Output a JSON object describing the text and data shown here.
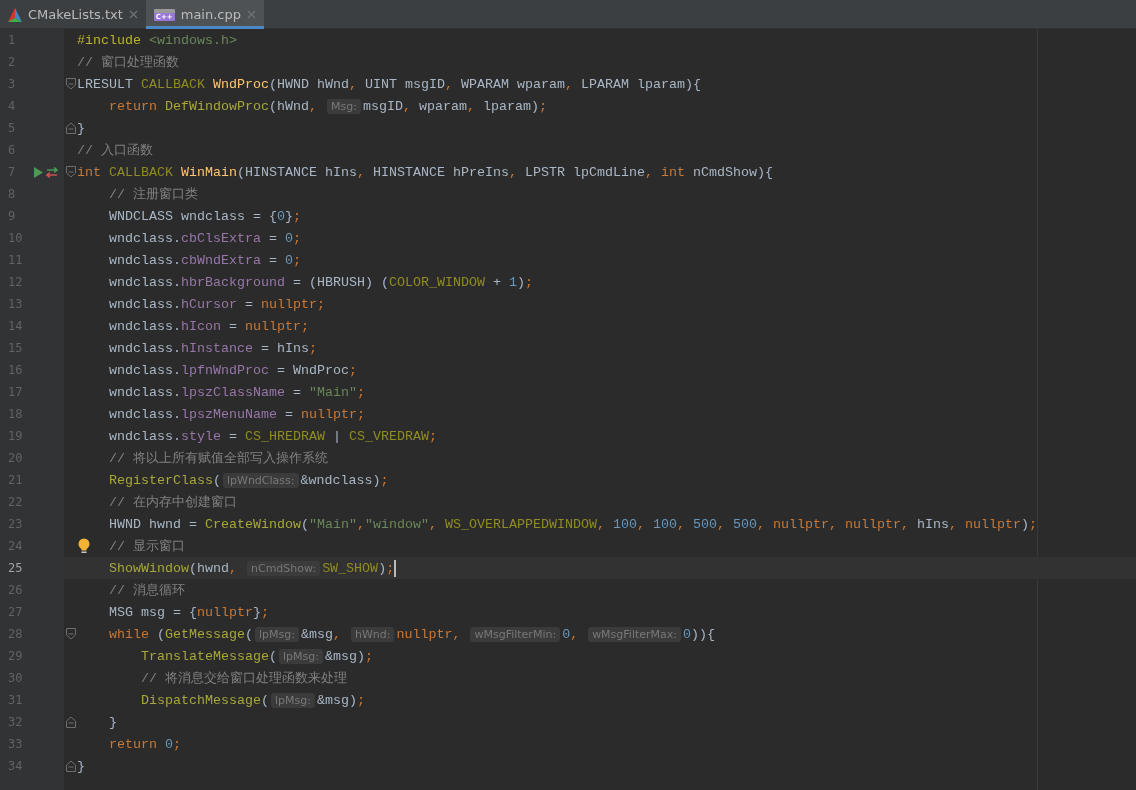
{
  "tabs": [
    {
      "label": "CMakeLists.txt",
      "kind": "cmake",
      "selected": false
    },
    {
      "label": "main.cpp",
      "kind": "cpp",
      "badge": "C++",
      "selected": true
    }
  ],
  "lines": [
    {
      "number": "1",
      "current": false,
      "tokens": [
        {
          "kind": "pre",
          "text": "#include"
        },
        {
          "kind": "str",
          "text": " <windows.h>"
        }
      ]
    },
    {
      "number": "2",
      "current": false,
      "tokens": [
        {
          "kind": "comment",
          "text": "// 窗口处理函数"
        }
      ]
    },
    {
      "number": "3",
      "current": false,
      "fold": {
        "kind": "open"
      },
      "tokens": [
        {
          "kind": "plain",
          "text": "LRESULT"
        },
        {
          "kind": "macro",
          "text": " CALLBACK"
        },
        {
          "kind": "fn",
          "text": " WndProc"
        },
        {
          "kind": "plain",
          "text": "(HWND hWnd"
        },
        {
          "kind": "punct",
          "text": ", "
        },
        {
          "kind": "plain",
          "text": "UINT msgID"
        },
        {
          "kind": "punct",
          "text": ", "
        },
        {
          "kind": "plain",
          "text": "WPARAM wparam"
        },
        {
          "kind": "punct",
          "text": ", "
        },
        {
          "kind": "plain",
          "text": "LPARAM lparam){"
        }
      ]
    },
    {
      "number": "4",
      "current": false,
      "tokens": [
        {
          "kind": "kw",
          "text": "    return"
        },
        {
          "kind": "call",
          "text": " DefWindowProc"
        },
        {
          "kind": "plain",
          "text": "(hWnd"
        },
        {
          "kind": "punct",
          "text": ", "
        },
        {
          "kind": "hint",
          "text": "Msg:"
        },
        {
          "kind": "plain",
          "text": "msgID"
        },
        {
          "kind": "punct",
          "text": ", "
        },
        {
          "kind": "plain",
          "text": "wparam"
        },
        {
          "kind": "punct",
          "text": ", "
        },
        {
          "kind": "plain",
          "text": "lparam)"
        },
        {
          "kind": "punct",
          "text": ";"
        }
      ]
    },
    {
      "number": "5",
      "current": false,
      "fold": {
        "kind": "close"
      },
      "tokens": [
        {
          "kind": "plain",
          "text": "}"
        }
      ]
    },
    {
      "number": "6",
      "current": false,
      "tokens": [
        {
          "kind": "comment",
          "text": "// 入口函数"
        }
      ]
    },
    {
      "number": "7",
      "current": false,
      "gutter": [
        {
          "kind": "run"
        },
        {
          "kind": "swap"
        }
      ],
      "fold": {
        "kind": "open"
      },
      "tokens": [
        {
          "kind": "kw",
          "text": "int"
        },
        {
          "kind": "macro",
          "text": " CALLBACK"
        },
        {
          "kind": "fn",
          "text": " WinMain"
        },
        {
          "kind": "plain",
          "text": "(HINSTANCE hIns"
        },
        {
          "kind": "punct",
          "text": ", "
        },
        {
          "kind": "plain",
          "text": "HINSTANCE hPreIns"
        },
        {
          "kind": "punct",
          "text": ", "
        },
        {
          "kind": "plain",
          "text": "LPSTR lpCmdLine"
        },
        {
          "kind": "punct",
          "text": ", "
        },
        {
          "kind": "kw",
          "text": "int"
        },
        {
          "kind": "plain",
          "text": " nCmdShow){"
        }
      ]
    },
    {
      "number": "8",
      "current": false,
      "tokens": [
        {
          "kind": "comment",
          "text": "    // 注册窗口类"
        }
      ]
    },
    {
      "number": "9",
      "current": false,
      "tokens": [
        {
          "kind": "plain",
          "text": "    WNDCLASS wndclass = {"
        },
        {
          "kind": "num",
          "text": "0"
        },
        {
          "kind": "plain",
          "text": "}"
        },
        {
          "kind": "punct",
          "text": ";"
        }
      ]
    },
    {
      "number": "10",
      "current": false,
      "tokens": [
        {
          "kind": "plain",
          "text": "    wndclass."
        },
        {
          "kind": "field",
          "text": "cbClsExtra"
        },
        {
          "kind": "plain",
          "text": " = "
        },
        {
          "kind": "num",
          "text": "0"
        },
        {
          "kind": "punct",
          "text": ";"
        }
      ]
    },
    {
      "number": "11",
      "current": false,
      "tokens": [
        {
          "kind": "plain",
          "text": "    wndclass."
        },
        {
          "kind": "field",
          "text": "cbWndExtra"
        },
        {
          "kind": "plain",
          "text": " = "
        },
        {
          "kind": "num",
          "text": "0"
        },
        {
          "kind": "punct",
          "text": ";"
        }
      ]
    },
    {
      "number": "12",
      "current": false,
      "tokens": [
        {
          "kind": "plain",
          "text": "    wndclass."
        },
        {
          "kind": "field",
          "text": "hbrBackground"
        },
        {
          "kind": "plain",
          "text": " = (HBRUSH) ("
        },
        {
          "kind": "macro",
          "text": "COLOR_WINDOW"
        },
        {
          "kind": "plain",
          "text": " + "
        },
        {
          "kind": "num",
          "text": "1"
        },
        {
          "kind": "plain",
          "text": ")"
        },
        {
          "kind": "punct",
          "text": ";"
        }
      ]
    },
    {
      "number": "13",
      "current": false,
      "tokens": [
        {
          "kind": "plain",
          "text": "    wndclass."
        },
        {
          "kind": "field",
          "text": "hCursor"
        },
        {
          "kind": "plain",
          "text": " = "
        },
        {
          "kind": "kw",
          "text": "nullptr"
        },
        {
          "kind": "punct",
          "text": ";"
        }
      ]
    },
    {
      "number": "14",
      "current": false,
      "tokens": [
        {
          "kind": "plain",
          "text": "    wndclass."
        },
        {
          "kind": "field",
          "text": "hIcon"
        },
        {
          "kind": "plain",
          "text": " = "
        },
        {
          "kind": "kw",
          "text": "nullptr"
        },
        {
          "kind": "punct",
          "text": ";"
        }
      ]
    },
    {
      "number": "15",
      "current": false,
      "tokens": [
        {
          "kind": "plain",
          "text": "    wndclass."
        },
        {
          "kind": "field",
          "text": "hInstance"
        },
        {
          "kind": "plain",
          "text": " = hIns"
        },
        {
          "kind": "punct",
          "text": ";"
        }
      ]
    },
    {
      "number": "16",
      "current": false,
      "tokens": [
        {
          "kind": "plain",
          "text": "    wndclass."
        },
        {
          "kind": "field",
          "text": "lpfnWndProc"
        },
        {
          "kind": "plain",
          "text": " = WndProc"
        },
        {
          "kind": "punct",
          "text": ";"
        }
      ]
    },
    {
      "number": "17",
      "current": false,
      "tokens": [
        {
          "kind": "plain",
          "text": "    wndclass."
        },
        {
          "kind": "field",
          "text": "lpszClassName"
        },
        {
          "kind": "plain",
          "text": " = "
        },
        {
          "kind": "str",
          "text": "\"Main\""
        },
        {
          "kind": "punct",
          "text": ";"
        }
      ]
    },
    {
      "number": "18",
      "current": false,
      "tokens": [
        {
          "kind": "plain",
          "text": "    wndclass."
        },
        {
          "kind": "field",
          "text": "lpszMenuName"
        },
        {
          "kind": "plain",
          "text": " = "
        },
        {
          "kind": "kw",
          "text": "nullptr"
        },
        {
          "kind": "punct",
          "text": ";"
        }
      ]
    },
    {
      "number": "19",
      "current": false,
      "tokens": [
        {
          "kind": "plain",
          "text": "    wndclass."
        },
        {
          "kind": "field",
          "text": "style"
        },
        {
          "kind": "plain",
          "text": " = "
        },
        {
          "kind": "macro",
          "text": "CS_HREDRAW"
        },
        {
          "kind": "plain",
          "text": " | "
        },
        {
          "kind": "macro",
          "text": "CS_VREDRAW"
        },
        {
          "kind": "punct",
          "text": ";"
        }
      ]
    },
    {
      "number": "20",
      "current": false,
      "tokens": [
        {
          "kind": "comment",
          "text": "    // 将以上所有赋值全部写入操作系统"
        }
      ]
    },
    {
      "number": "21",
      "current": false,
      "tokens": [
        {
          "kind": "call",
          "text": "    RegisterClass"
        },
        {
          "kind": "plain",
          "text": "("
        },
        {
          "kind": "hint",
          "text": "lpWndClass:"
        },
        {
          "kind": "plain",
          "text": "&wndclass)"
        },
        {
          "kind": "punct",
          "text": ";"
        }
      ]
    },
    {
      "number": "22",
      "current": false,
      "tokens": [
        {
          "kind": "comment",
          "text": "    // 在内存中创建窗口"
        }
      ]
    },
    {
      "number": "23",
      "current": false,
      "tokens": [
        {
          "kind": "plain",
          "text": "    HWND hwnd = "
        },
        {
          "kind": "call",
          "text": "CreateWindow"
        },
        {
          "kind": "plain",
          "text": "("
        },
        {
          "kind": "str",
          "text": "\"Main\""
        },
        {
          "kind": "punct",
          "text": ","
        },
        {
          "kind": "str",
          "text": "\"window\""
        },
        {
          "kind": "punct",
          "text": ", "
        },
        {
          "kind": "macro",
          "text": "WS_OVERLAPPEDWINDOW"
        },
        {
          "kind": "punct",
          "text": ", "
        },
        {
          "kind": "num",
          "text": "100"
        },
        {
          "kind": "punct",
          "text": ", "
        },
        {
          "kind": "num",
          "text": "100"
        },
        {
          "kind": "punct",
          "text": ", "
        },
        {
          "kind": "num",
          "text": "500"
        },
        {
          "kind": "punct",
          "text": ", "
        },
        {
          "kind": "num",
          "text": "500"
        },
        {
          "kind": "punct",
          "text": ", "
        },
        {
          "kind": "kw",
          "text": "nullptr"
        },
        {
          "kind": "punct",
          "text": ", "
        },
        {
          "kind": "kw",
          "text": "nullptr"
        },
        {
          "kind": "punct",
          "text": ", "
        },
        {
          "kind": "plain",
          "text": "hIns"
        },
        {
          "kind": "punct",
          "text": ", "
        },
        {
          "kind": "kw",
          "text": "nullptr"
        },
        {
          "kind": "plain",
          "text": ")"
        },
        {
          "kind": "punct",
          "text": ";"
        }
      ]
    },
    {
      "number": "24",
      "current": false,
      "gutter": [
        {
          "kind": "bulb"
        }
      ],
      "tokens": [
        {
          "kind": "comment",
          "text": "    // 显示窗口"
        }
      ]
    },
    {
      "number": "25",
      "current": true,
      "tokens": [
        {
          "kind": "call",
          "text": "    ShowWindow"
        },
        {
          "kind": "plain",
          "text": "(hwnd"
        },
        {
          "kind": "punct",
          "text": ", "
        },
        {
          "kind": "hint",
          "text": "nCmdShow:"
        },
        {
          "kind": "macro",
          "text": "SW_SHOW"
        },
        {
          "kind": "plain",
          "text": ")"
        },
        {
          "kind": "punct",
          "text": ";"
        }
      ]
    },
    {
      "number": "26",
      "current": false,
      "tokens": [
        {
          "kind": "comment",
          "text": "    // 消息循环"
        }
      ]
    },
    {
      "number": "27",
      "current": false,
      "tokens": [
        {
          "kind": "plain",
          "text": "    MSG msg = {"
        },
        {
          "kind": "kw",
          "text": "nullptr"
        },
        {
          "kind": "plain",
          "text": "}"
        },
        {
          "kind": "punct",
          "text": ";"
        }
      ]
    },
    {
      "number": "28",
      "current": false,
      "fold": {
        "kind": "open"
      },
      "tokens": [
        {
          "kind": "kw",
          "text": "    while"
        },
        {
          "kind": "plain",
          "text": " ("
        },
        {
          "kind": "call",
          "text": "GetMessage"
        },
        {
          "kind": "plain",
          "text": "("
        },
        {
          "kind": "hint",
          "text": "lpMsg:"
        },
        {
          "kind": "plain",
          "text": "&msg"
        },
        {
          "kind": "punct",
          "text": ", "
        },
        {
          "kind": "hint",
          "text": "hWnd:"
        },
        {
          "kind": "kw",
          "text": "nullptr"
        },
        {
          "kind": "punct",
          "text": ", "
        },
        {
          "kind": "hint",
          "text": "wMsgFilterMin:"
        },
        {
          "kind": "num",
          "text": "0"
        },
        {
          "kind": "punct",
          "text": ", "
        },
        {
          "kind": "hint",
          "text": "wMsgFilterMax:"
        },
        {
          "kind": "num",
          "text": "0"
        },
        {
          "kind": "plain",
          "text": ")){"
        }
      ]
    },
    {
      "number": "29",
      "current": false,
      "tokens": [
        {
          "kind": "call",
          "text": "        TranslateMessage"
        },
        {
          "kind": "plain",
          "text": "("
        },
        {
          "kind": "hint",
          "text": "lpMsg:"
        },
        {
          "kind": "plain",
          "text": "&msg)"
        },
        {
          "kind": "punct",
          "text": ";"
        }
      ]
    },
    {
      "number": "30",
      "current": false,
      "tokens": [
        {
          "kind": "comment",
          "text": "        // 将消息交给窗口处理函数来处理"
        }
      ]
    },
    {
      "number": "31",
      "current": false,
      "tokens": [
        {
          "kind": "call",
          "text": "        DispatchMessage"
        },
        {
          "kind": "plain",
          "text": "("
        },
        {
          "kind": "hint",
          "text": "lpMsg:"
        },
        {
          "kind": "plain",
          "text": "&msg)"
        },
        {
          "kind": "punct",
          "text": ";"
        }
      ]
    },
    {
      "number": "32",
      "current": false,
      "fold": {
        "kind": "close"
      },
      "tokens": [
        {
          "kind": "plain",
          "text": "    }"
        }
      ]
    },
    {
      "number": "33",
      "current": false,
      "tokens": [
        {
          "kind": "kw",
          "text": "    return"
        },
        {
          "kind": "num",
          "text": " 0"
        },
        {
          "kind": "punct",
          "text": ";"
        }
      ]
    },
    {
      "number": "34",
      "current": false,
      "fold": {
        "kind": "close"
      },
      "tokens": [
        {
          "kind": "plain",
          "text": "}"
        }
      ]
    }
  ]
}
